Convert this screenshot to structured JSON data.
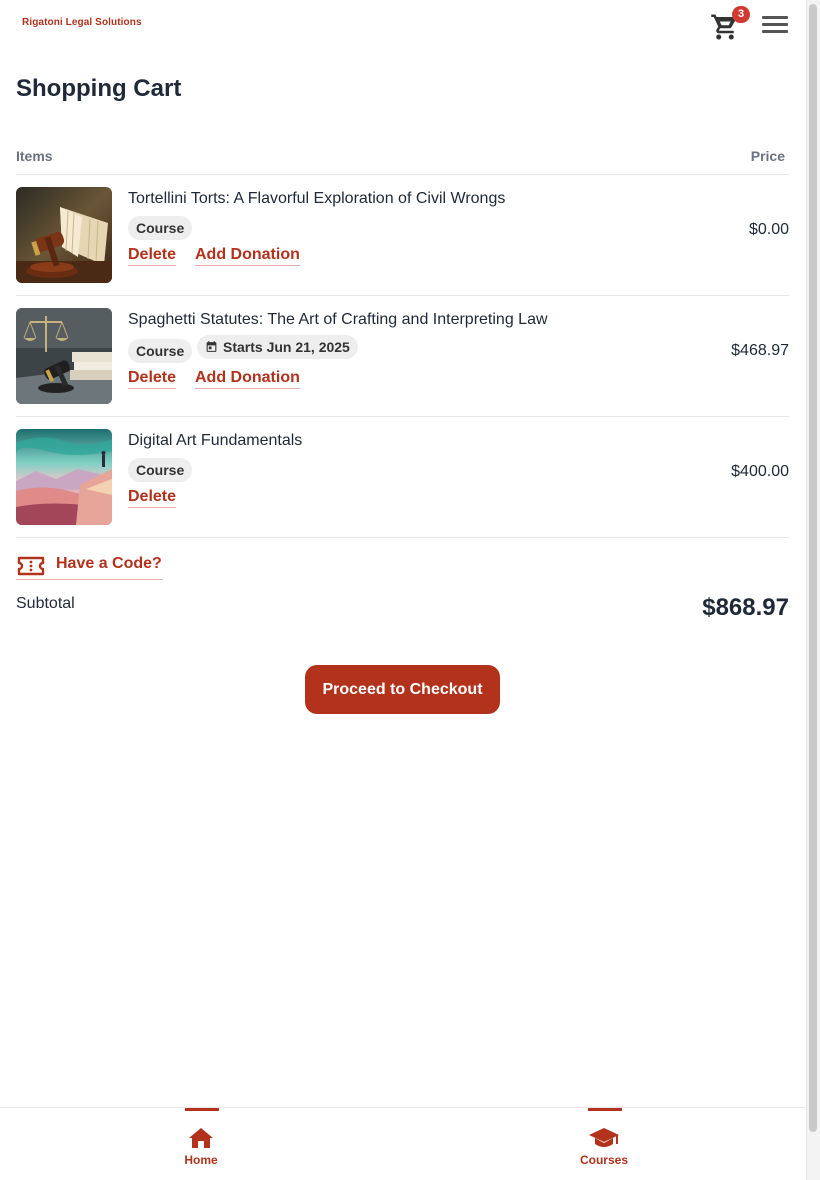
{
  "header": {
    "logo_text": "Rigatoni Legal Solutions",
    "cart_count": "3",
    "cart_icon": "cart-icon",
    "menu_icon": "hamburger-menu-icon"
  },
  "page": {
    "title": "Shopping Cart",
    "col_items": "Items",
    "col_price": "Price"
  },
  "items": [
    {
      "title": "Tortellini Torts: A Flavorful Exploration of Civil Wrongs",
      "tag": "Course",
      "date_tag": "",
      "delete_label": "Delete",
      "donation_label": "Add Donation",
      "price": "$0.00"
    },
    {
      "title": "Spaghetti Statutes: The Art of Crafting and Interpreting Law",
      "tag": "Course",
      "date_tag": "Starts Jun 21, 2025",
      "delete_label": "Delete",
      "donation_label": "Add Donation",
      "price": "$468.97"
    },
    {
      "title": "Digital Art Fundamentals",
      "tag": "Course",
      "date_tag": "",
      "delete_label": "Delete",
      "donation_label": "",
      "price": "$400.00"
    }
  ],
  "code": {
    "label": "Have a Code?",
    "icon": "ticket-icon"
  },
  "summary": {
    "subtotal_label": "Subtotal",
    "subtotal_value": "$868.97"
  },
  "checkout": {
    "label": "Proceed to Checkout"
  },
  "bottom_nav": {
    "home_label": "Home",
    "courses_label": "Courses"
  },
  "colors": {
    "accent": "#b2321c",
    "badge": "#d03a30",
    "text": "#1f2937",
    "muted": "#6b7280"
  }
}
